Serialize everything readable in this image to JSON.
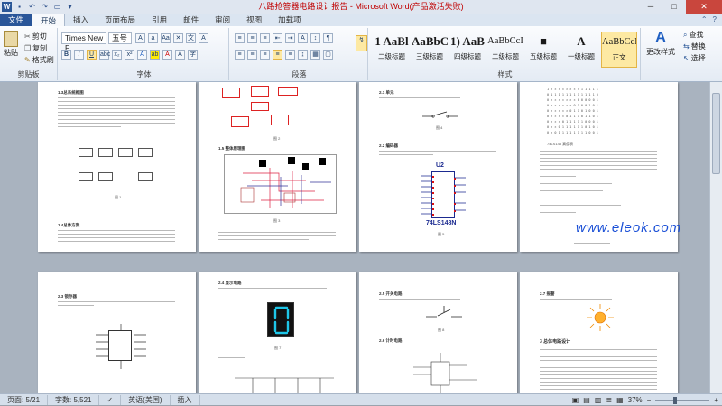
{
  "window": {
    "title": "八路抢答器电路设计报告 - Microsoft Word(产品激活失败)",
    "minimize_glyph": "─",
    "maximize_glyph": "□",
    "close_glyph": "✕"
  },
  "quick_access": [
    "word-logo-icon",
    "save-icon",
    "undo-icon",
    "redo-icon",
    "open-icon",
    "customize-icon"
  ],
  "tabs": [
    "文件",
    "开始",
    "插入",
    "页面布局",
    "引用",
    "邮件",
    "审阅",
    "视图",
    "加载项"
  ],
  "active_tab": "开始",
  "ribbon": {
    "clipboard": {
      "label": "剪贴板",
      "paste": "粘贴",
      "cut": "剪切",
      "copy": "复制",
      "format_painter": "格式刷"
    },
    "font": {
      "label": "字体",
      "font_name": "Times New F",
      "font_size": "五号",
      "bold": "B",
      "italic": "I",
      "underline": "U"
    },
    "paragraph": {
      "label": "段落"
    },
    "styles": {
      "label": "样式",
      "items": [
        {
          "sample": "1 AaBl",
          "name": "二级标题"
        },
        {
          "sample": "AaBbCc",
          "name": "三级标题"
        },
        {
          "sample": "1) AaB",
          "name": "四级标题"
        },
        {
          "sample": "AaBbCcI",
          "name": "二级标题"
        },
        {
          "sample": "■",
          "name": "五级标题"
        },
        {
          "sample": "A",
          "name": "一级标题"
        },
        {
          "sample": "AaBbCcI",
          "name": "正文"
        }
      ],
      "change_styles": "更改样式"
    },
    "editing": {
      "find": "查找",
      "replace": "替换",
      "select": "选择"
    }
  },
  "pages": {
    "p1_heading1": "1.3总系统框图",
    "p1_caption1": "图 1",
    "p1_heading2": "1.4总体方案",
    "p2_caption1": "图 2",
    "p2_heading1": "1.5 整体原理图",
    "p2_caption2": "图 3",
    "p3_heading1": "2.1 单元",
    "p3_caption1": "图 4",
    "p3_heading2": "2.2 编码器",
    "p3_chip_label": "U2",
    "p3_chip_name": "74LS148N",
    "p3_caption2": "图 5",
    "p4_note": "74LS148 真值表",
    "p5_heading1": "2.3 锁存器",
    "p5_caption1": "图 6",
    "p6_heading1": "2.4 显示电路",
    "p6_caption1": "图 7",
    "p7_heading1": "2.5 开关电路",
    "p7_caption1": "图 8",
    "p7_heading2": "2.6 计时电路",
    "p8_heading1": "2.7 报警",
    "p8_heading2": "3 总体电路设计",
    "watermark": "www.eleok.com"
  },
  "status": {
    "page": "页面: 5/21",
    "words": "字数: 5,521",
    "language": "英语(美国)",
    "mode": "插入",
    "zoom": "37%"
  },
  "colors": {
    "file_tab": "#2a5699",
    "watermark": "#1a4fd6",
    "title_text": "#c00000",
    "selected_style": "#fde9a3"
  }
}
